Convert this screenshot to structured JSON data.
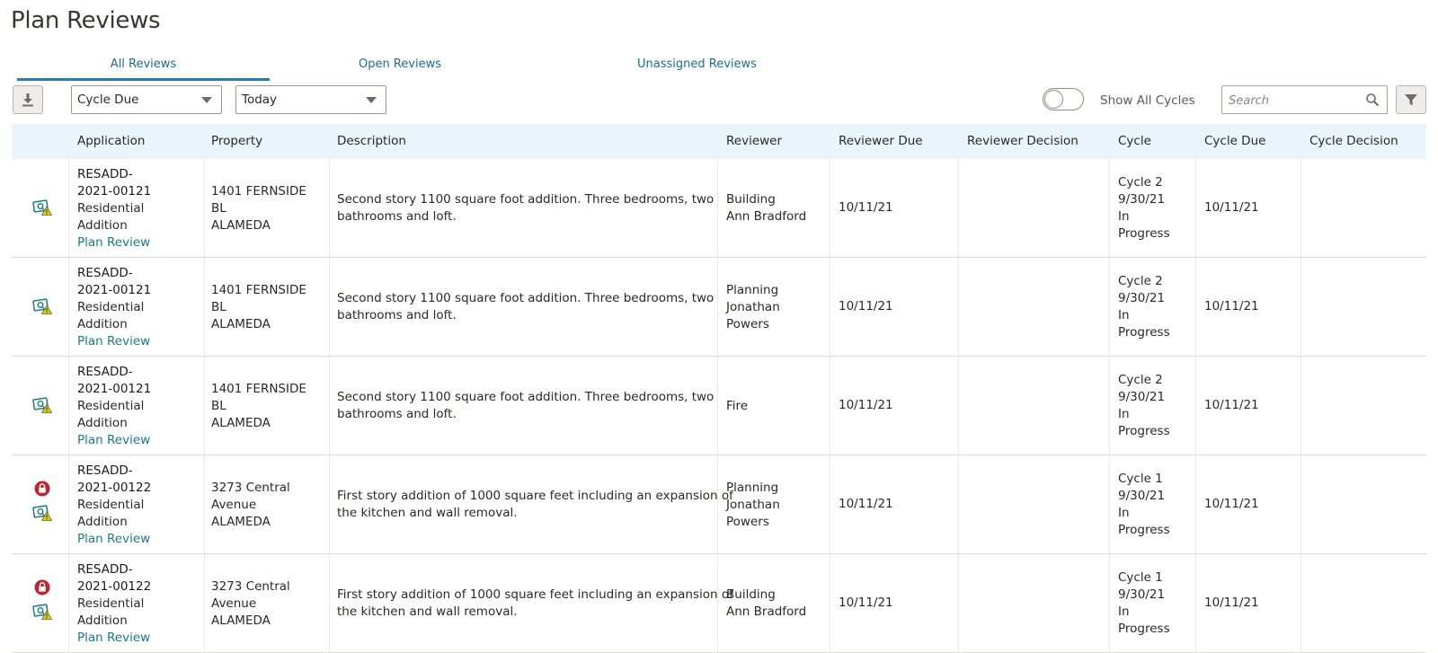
{
  "page": {
    "title": "Plan Reviews"
  },
  "tabs": [
    {
      "label": "All Reviews",
      "active": true
    },
    {
      "label": "Open Reviews",
      "active": false
    },
    {
      "label": "Unassigned Reviews",
      "active": false
    }
  ],
  "toolbar": {
    "date_field": "Cycle Due",
    "date_range": "Today",
    "toggle_label": "Show All Cycles",
    "toggle_on": false,
    "search_placeholder": "Search"
  },
  "columns": [
    "Application",
    "Property",
    "Description",
    "Reviewer",
    "Reviewer Due",
    "Reviewer Decision",
    "Cycle",
    "Cycle Due",
    "Cycle Decision"
  ],
  "rows": [
    {
      "locked": false,
      "app_id_1": "RESADD-",
      "app_id_2": "2021-00121",
      "app_type_1": "Residential",
      "app_type_2": "Addition",
      "app_link": "Plan Review",
      "prop_1": "1401 FERNSIDE",
      "prop_2": "BL",
      "prop_3": "ALAMEDA",
      "desc_1": "Second story 1100 square foot addition. Three bedrooms, two",
      "desc_2": "bathrooms and loft.",
      "rev_1": "Building",
      "rev_2": "Ann Bradford",
      "rev_3": "",
      "rev_due": "10/11/21",
      "rev_decision": "",
      "cyc_1": "Cycle 2",
      "cyc_2": "9/30/21",
      "cyc_3": "In",
      "cyc_4": "Progress",
      "cycle_due": "10/11/21",
      "cycle_decision": ""
    },
    {
      "locked": false,
      "app_id_1": "RESADD-",
      "app_id_2": "2021-00121",
      "app_type_1": "Residential",
      "app_type_2": "Addition",
      "app_link": "Plan Review",
      "prop_1": "1401 FERNSIDE",
      "prop_2": "BL",
      "prop_3": "ALAMEDA",
      "desc_1": "Second story 1100 square foot addition. Three bedrooms, two",
      "desc_2": "bathrooms and loft.",
      "rev_1": "Planning",
      "rev_2": "Jonathan",
      "rev_3": "Powers",
      "rev_due": "10/11/21",
      "rev_decision": "",
      "cyc_1": "Cycle 2",
      "cyc_2": "9/30/21",
      "cyc_3": "In",
      "cyc_4": "Progress",
      "cycle_due": "10/11/21",
      "cycle_decision": ""
    },
    {
      "locked": false,
      "app_id_1": "RESADD-",
      "app_id_2": "2021-00121",
      "app_type_1": "Residential",
      "app_type_2": "Addition",
      "app_link": "Plan Review",
      "prop_1": "1401 FERNSIDE",
      "prop_2": "BL",
      "prop_3": "ALAMEDA",
      "desc_1": "Second story 1100 square foot addition. Three bedrooms, two",
      "desc_2": "bathrooms and loft.",
      "rev_1": "Fire",
      "rev_2": "",
      "rev_3": "",
      "rev_due": "10/11/21",
      "rev_decision": "",
      "cyc_1": "Cycle 2",
      "cyc_2": "9/30/21",
      "cyc_3": "In",
      "cyc_4": "Progress",
      "cycle_due": "10/11/21",
      "cycle_decision": ""
    },
    {
      "locked": true,
      "app_id_1": "RESADD-",
      "app_id_2": "2021-00122",
      "app_type_1": "Residential",
      "app_type_2": "Addition",
      "app_link": "Plan Review",
      "prop_1": "3273 Central",
      "prop_2": "Avenue",
      "prop_3": "ALAMEDA",
      "desc_1": "First story addition of 1000 square feet including an expansion of",
      "desc_2": "the kitchen and wall removal.",
      "rev_1": "Planning",
      "rev_2": "Jonathan",
      "rev_3": "Powers",
      "rev_due": "10/11/21",
      "rev_decision": "",
      "cyc_1": "Cycle 1",
      "cyc_2": "9/30/21",
      "cyc_3": "In",
      "cyc_4": "Progress",
      "cycle_due": "10/11/21",
      "cycle_decision": ""
    },
    {
      "locked": true,
      "app_id_1": "RESADD-",
      "app_id_2": "2021-00122",
      "app_type_1": "Residential",
      "app_type_2": "Addition",
      "app_link": "Plan Review",
      "prop_1": "3273 Central",
      "prop_2": "Avenue",
      "prop_3": "ALAMEDA",
      "desc_1": "First story addition of 1000 square feet including an expansion of",
      "desc_2": "the kitchen and wall removal.",
      "rev_1": "Building",
      "rev_2": "Ann Bradford",
      "rev_3": "",
      "rev_due": "10/11/21",
      "rev_decision": "",
      "cyc_1": "Cycle 1",
      "cyc_2": "9/30/21",
      "cyc_3": "In",
      "cyc_4": "Progress",
      "cycle_due": "10/11/21",
      "cycle_decision": ""
    }
  ]
}
